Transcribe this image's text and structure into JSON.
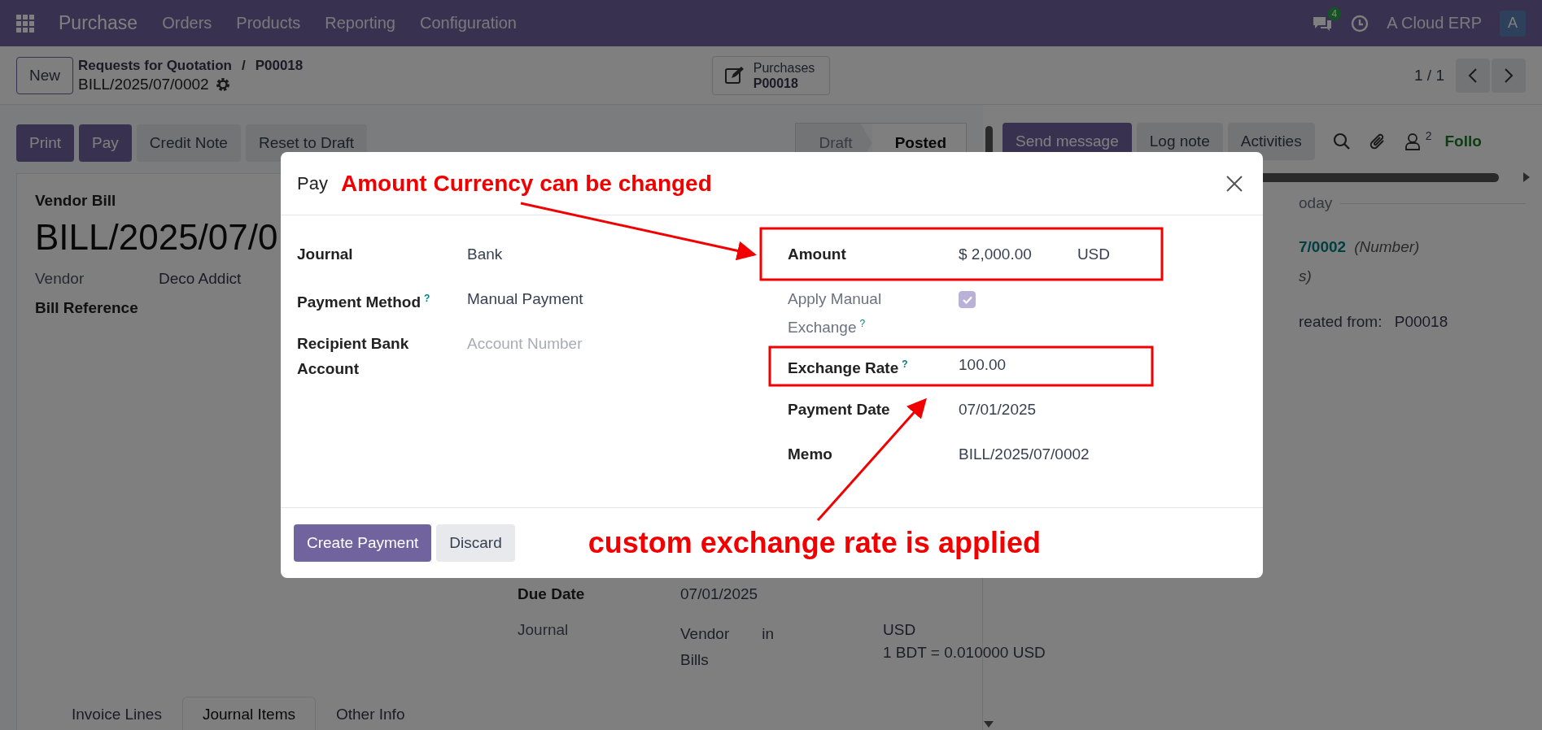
{
  "navbar": {
    "app": "Purchase",
    "menus": [
      "Orders",
      "Products",
      "Reporting",
      "Configuration"
    ],
    "messages_badge": "4",
    "company": "A Cloud ERP",
    "avatar": "A"
  },
  "control_panel": {
    "new_button": "New",
    "breadcrumb": [
      "Requests for Quotation",
      "P00018"
    ],
    "separator": "/",
    "record": "BILL/2025/07/0002",
    "smart_button": {
      "label": "Purchases",
      "value": "P00018"
    },
    "pager": "1 / 1"
  },
  "actions": [
    {
      "label": "Print",
      "kind": "primary"
    },
    {
      "label": "Pay",
      "kind": "primary"
    },
    {
      "label": "Credit Note",
      "kind": "secondary"
    },
    {
      "label": "Reset to Draft",
      "kind": "secondary"
    }
  ],
  "status_steps": [
    {
      "label": "Draft",
      "selected": false
    },
    {
      "label": "Posted",
      "selected": true
    }
  ],
  "chatter": {
    "buttons": [
      {
        "label": "Send message",
        "kind": "primary"
      },
      {
        "label": "Log note",
        "kind": "secondary"
      },
      {
        "label": "Activities",
        "kind": "secondary"
      }
    ],
    "followers_count": "2",
    "follow_label": "Follo",
    "date_divider": "oday",
    "lines": [
      {
        "parts": [
          {
            "kind": "link",
            "text": "7/0002"
          },
          {
            "kind": "italic",
            "text": "(Number)"
          }
        ]
      },
      {
        "parts": [
          {
            "kind": "italic",
            "text": "s)"
          }
        ]
      },
      {
        "parts": [
          {
            "kind": "plain",
            "text": "reated from: "
          },
          {
            "kind": "link",
            "text": "P00018"
          }
        ]
      }
    ]
  },
  "form": {
    "type_label": "Vendor Bill",
    "name": "BILL/2025/07/0",
    "vendor": {
      "label": "Vendor",
      "value": "Deco Addict"
    },
    "bill_reference": {
      "label": "Bill Reference"
    },
    "due_date": {
      "label": "Due Date",
      "value": "07/01/2025"
    },
    "journal": {
      "label": "Journal",
      "value": "Vendor in Bills",
      "currency": "USD",
      "rate": "1 BDT = 0.010000 USD"
    },
    "tabs": [
      {
        "label": "Invoice Lines",
        "selected": false
      },
      {
        "label": "Journal Items",
        "selected": true
      },
      {
        "label": "Other Info",
        "selected": false
      }
    ]
  },
  "dialog": {
    "title": "Pay",
    "left_fields": [
      {
        "label": "Journal",
        "kind": "text",
        "value": "Bank"
      },
      {
        "label": "Payment Method",
        "help": "?",
        "kind": "text",
        "value": "Manual Payment"
      },
      {
        "label": "Recipient Bank Account",
        "kind": "input",
        "placeholder": "Account Number"
      }
    ],
    "right_fields": [
      {
        "label": "Amount",
        "kind": "amount",
        "value": "$ 2,000.00",
        "currency": "USD"
      },
      {
        "label": "Apply Manual Exchange",
        "help": "?",
        "kind": "checkbox",
        "checked": true,
        "disabled": true
      },
      {
        "label": "Exchange Rate",
        "help": "?",
        "kind": "text",
        "value": "100.00"
      },
      {
        "label": "Payment Date",
        "kind": "text",
        "value": "07/01/2025"
      },
      {
        "label": "Memo",
        "kind": "text",
        "value": "BILL/2025/07/0002"
      }
    ],
    "buttons": [
      {
        "label": "Create Payment",
        "kind": "primary"
      },
      {
        "label": "Discard",
        "kind": "secondary"
      }
    ]
  },
  "annotations": [
    "Amount Currency can be changed",
    "custom exchange rate is applied"
  ]
}
